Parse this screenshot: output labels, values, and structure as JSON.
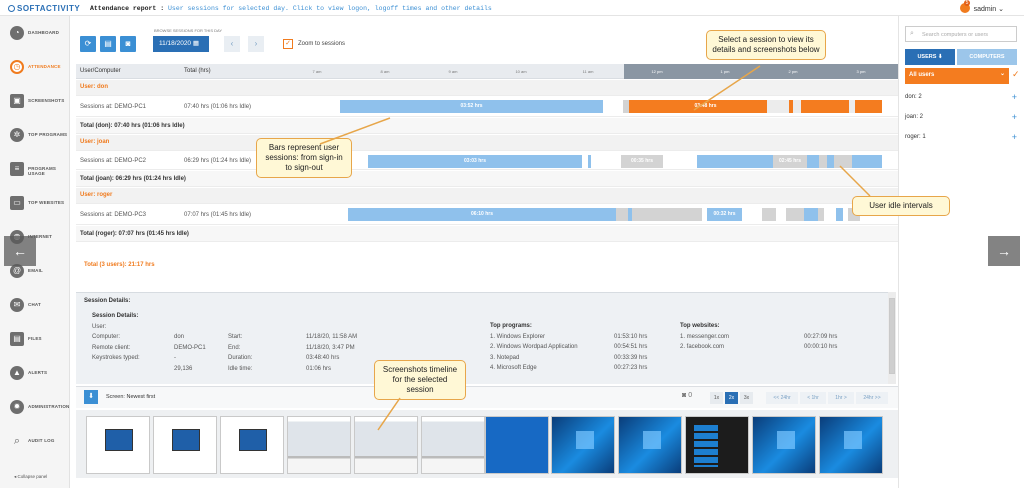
{
  "app": {
    "logo": "SOFTACTIVITY",
    "report_title": "Attendance report :",
    "report_subtitle": "User sessions for selected day. Click to view logon, logoff times and other details",
    "user": "sadmin",
    "notifications": "5"
  },
  "sidebar": {
    "items": [
      {
        "label": "DASHBOARD",
        "icon": "dashboard-icon"
      },
      {
        "label": "ATTENDANCE",
        "icon": "clock-icon"
      },
      {
        "label": "SCREENSHOTS",
        "icon": "camera-icon"
      },
      {
        "label": "TOP PROGRAMS",
        "icon": "cog-icon"
      },
      {
        "label": "PROGRAMS USAGE",
        "icon": "list-icon"
      },
      {
        "label": "TOP WEBSITES",
        "icon": "browser-icon"
      },
      {
        "label": "INTERNET",
        "icon": "globe-icon"
      },
      {
        "label": "EMAIL",
        "icon": "at-icon"
      },
      {
        "label": "CHAT",
        "icon": "chat-icon"
      },
      {
        "label": "FILES",
        "icon": "file-icon"
      },
      {
        "label": "ALERTS",
        "icon": "warning-icon"
      },
      {
        "label": "ADMINISTRATION",
        "icon": "gear-icon"
      },
      {
        "label": "AUDIT LOG",
        "icon": "search-icon"
      }
    ],
    "collapse": "Collapse panel"
  },
  "toolbar": {
    "browse_label": "BROWSE SESSIONS FOR THIS DAY",
    "date": "11/18/2020",
    "zoom_label": "Zoom to sessions"
  },
  "grid": {
    "col_user": "User/Computer",
    "col_total": "Total (hrs)",
    "hours": [
      "7 am",
      "8 am",
      "9 am",
      "10 am",
      "11 am",
      "12 pm",
      "1 pm",
      "2 pm",
      "3 pm"
    ],
    "users": [
      {
        "name": "User: don",
        "session": "Sessions at: DEMO-PC1",
        "time": "07:40 hrs (01:06 hrs Idle)",
        "total": "Total (don): 07:40 hrs (01:06 hrs Idle)",
        "bar1": "03:52 hrs",
        "bar2": "03:48 hrs"
      },
      {
        "name": "User: joan",
        "session": "Sessions at: DEMO-PC2",
        "time": "06:29 hrs (01:24 hrs Idle)",
        "total": "Total (joan): 06:29 hrs (01:24 hrs Idle)",
        "bar1": "03:03 hrs",
        "bar2": "00:35 hrs",
        "bar3": "02:45 hrs"
      },
      {
        "name": "User: roger",
        "session": "Sessions at: DEMO-PC3",
        "time": "07:07 hrs (01:45 hrs Idle)",
        "total": "Total (roger): 07:07 hrs (01:45 hrs Idle)",
        "bar1": "06:10 hrs",
        "bar2": "00:32 hrs"
      }
    ],
    "grand_total": "Total (3 users): 21:17 hrs"
  },
  "details": {
    "panel_title": "Session Details:",
    "heading": "Session Details:",
    "labels": [
      "User:",
      "Computer:",
      "Remote client:",
      "Keystrokes typed:"
    ],
    "values": [
      "don",
      "DEMO-PC1",
      "-",
      "29,136"
    ],
    "labels2": [
      "Start:",
      "End:",
      "Duration:",
      "Idle time:"
    ],
    "values2": [
      "11/18/20, 11:58 AM",
      "11/18/20, 3:47 PM",
      "03:48:40 hrs",
      "01:06 hrs"
    ],
    "programs_heading": "Top programs:",
    "programs": [
      "1. Windows Explorer",
      "2. Windows Wordpad Application",
      "3. Notepad",
      "4. Microsoft Edge"
    ],
    "program_times": [
      "01:53:10 hrs",
      "00:54:51 hrs",
      "00:33:39 hrs",
      "00:27:23 hrs"
    ],
    "websites_heading": "Top websites:",
    "websites": [
      "1. messenger.com",
      "2. facebook.com"
    ],
    "website_times": [
      "00:27:09 hrs",
      "00:00:10 hrs"
    ]
  },
  "screenshots": {
    "label": "Screen: Newest first",
    "count": "0",
    "zooms": [
      "1x",
      "2x",
      "3x"
    ],
    "nav": [
      "<< 24hr",
      "< 1hr",
      "1hr >",
      "24hr >>"
    ]
  },
  "right_panel": {
    "search_placeholder": "Search computers or users",
    "tab_users": "USERS",
    "tab_computers": "COMPUTERS",
    "all_users": "All users",
    "users": [
      "don: 2",
      "joan: 2",
      "roger: 1"
    ]
  },
  "callouts": {
    "select": "Select a session to view its details and screenshots below",
    "bars": "Bars represent user sessions: from sign-in to sign-out",
    "idle": "User idle intervals",
    "timeline": "Screenshots timeline for the selected session"
  },
  "colors": {
    "accent": "#f07b1e",
    "primary": "#2a6fb5",
    "session_bar": "#8fc1ec",
    "selected_bar": "#f47c1f",
    "idle_bar": "#d3d3d3"
  }
}
